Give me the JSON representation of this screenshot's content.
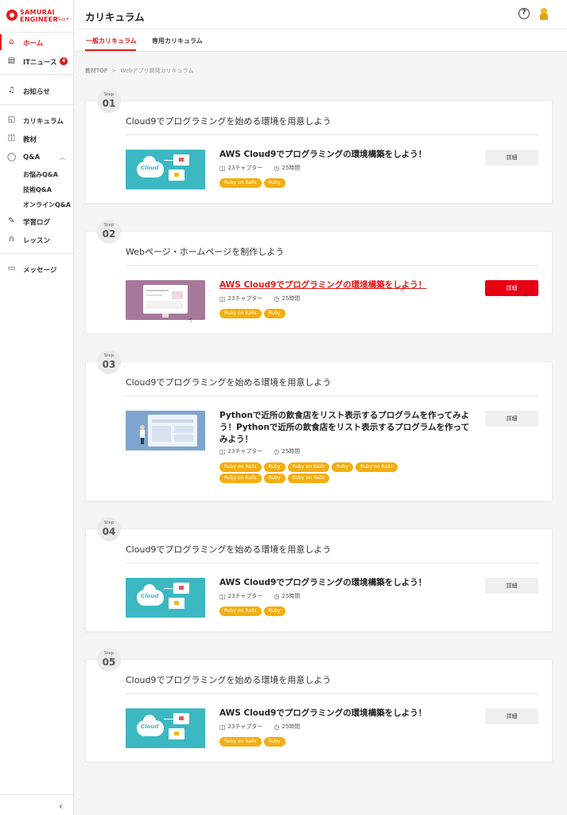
{
  "brand": {
    "line1": "SAMURAI",
    "line2": "ENGINEER",
    "line3": "Plus+"
  },
  "sidebar": {
    "items": [
      {
        "label": "ホーム",
        "icon": "home-icon",
        "glyph": "⌂"
      },
      {
        "label": "ITニュース",
        "icon": "news-icon",
        "glyph": "▤",
        "badge": "4"
      },
      {
        "label": "お知らせ",
        "icon": "bell-icon",
        "glyph": "♫"
      },
      {
        "label": "カリキュラム",
        "icon": "curriculum-icon",
        "glyph": "◱"
      },
      {
        "label": "教材",
        "icon": "book-icon",
        "glyph": "◫"
      },
      {
        "label": "Q&A",
        "icon": "qa-icon",
        "glyph": "◯"
      },
      {
        "label": "学習ログ",
        "icon": "pencil-icon",
        "glyph": "✎"
      },
      {
        "label": "レッスン",
        "icon": "headset-icon",
        "glyph": "∩"
      },
      {
        "label": "メッセージ",
        "icon": "message-icon",
        "glyph": "▭"
      }
    ],
    "qa_sub": [
      "お悩みQ&A",
      "技術Q&A",
      "オンラインQ&A"
    ],
    "collapse_glyph": "‹"
  },
  "header": {
    "title": "カリキュラム",
    "help_glyph": "?"
  },
  "tabs": [
    "一般カリキュラム",
    "専用カリキュラム"
  ],
  "breadcrumb": {
    "root": "教材TOP",
    "sep": ">",
    "current": "Webアプリ開発カリキュラム"
  },
  "steps": [
    {
      "step_label": "Step",
      "number": "01",
      "title": "Cloud9でプログラミングを始める環境を用意しよう",
      "course": "AWS Cloud9でプログラミングの環境構築をしよう！",
      "chapters": "23チャプター",
      "hours": "25時間",
      "tags": [
        "Ruby on Rails",
        "Ruby"
      ],
      "button": "詳細"
    },
    {
      "step_label": "Step",
      "number": "02",
      "title": "Webページ・ホームページを制作しよう",
      "course": "AWS Cloud9でプログラミングの環境構築をしよう！",
      "chapters": "23チャプター",
      "hours": "25時間",
      "tags": [
        "Ruby on Rails",
        "Ruby"
      ],
      "button": "詳細"
    },
    {
      "step_label": "Step",
      "number": "03",
      "title": "Cloud9でプログラミングを始める環境を用意しよう",
      "course": "Pythonで近所の飲食店をリスト表示するプログラムを作ってみよう！Pythonで近所の飲食店をリスト表示するプログラムを作ってみよう！",
      "chapters": "23チャプター",
      "hours": "25時間",
      "tags": [
        "Ruby on Rails",
        "Ruby",
        "Ruby on Rails",
        "Ruby",
        "Ruby on Rails",
        "Ruby on Rails",
        "Ruby",
        "Ruby on Rails"
      ],
      "button": "詳細"
    },
    {
      "step_label": "Step",
      "number": "04",
      "title": "Cloud9でプログラミングを始める環境を用意しよう",
      "course": "AWS Cloud9でプログラミングの環境構築をしよう！",
      "chapters": "23チャプター",
      "hours": "25時間",
      "tags": [
        "Ruby on Rails",
        "Ruby"
      ],
      "button": "詳細"
    },
    {
      "step_label": "Step",
      "number": "05",
      "title": "Cloud9でプログラミングを始める環境を用意しよう",
      "course": "AWS Cloud9でプログラミングの環境構築をしよう！",
      "chapters": "23チャプター",
      "hours": "25時間",
      "tags": [
        "Ruby on Rails",
        "Ruby"
      ],
      "button": "詳細"
    }
  ],
  "thumb_cloud_text": "Cloud",
  "meta_icons": {
    "chapters": "◫",
    "hours": "◷"
  },
  "colors": {
    "accent": "#e21a1a",
    "tag": "#f3ae10",
    "button_active": "#e60012"
  }
}
